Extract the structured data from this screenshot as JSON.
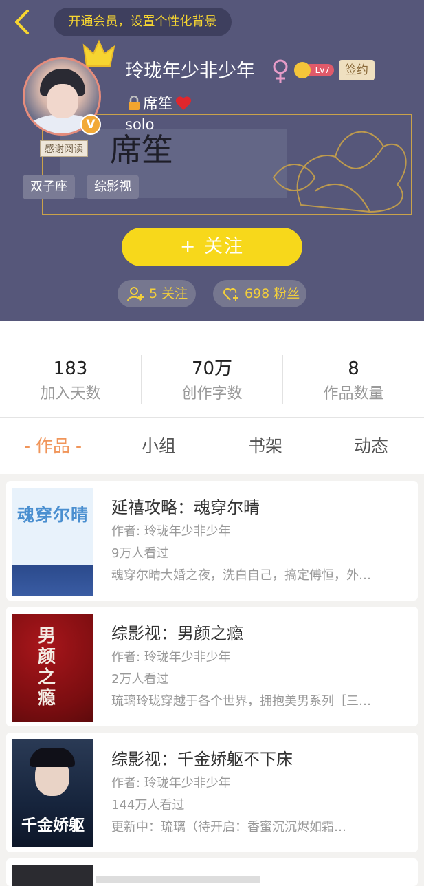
{
  "header": {
    "vip_banner": "开通会员，设置个性化背景",
    "avatar_caption": "感谢阅读",
    "badge_letter": "V",
    "tags": [
      "双子座",
      "综影视"
    ],
    "name": "玲珑年少非少年",
    "level": "Lv7",
    "signed": "签约",
    "pen_name": "席笙",
    "bio": "solo",
    "signature_text": "席笙",
    "follow_button": "+ 关注",
    "following": "5 关注",
    "fans": "698 粉丝",
    "colors": {
      "bg": "#56577a",
      "accent": "#f7d81b",
      "gold": "#f3cf3b"
    }
  },
  "stats": [
    {
      "value": "183",
      "label": "加入天数"
    },
    {
      "value": "70万",
      "label": "创作字数"
    },
    {
      "value": "8",
      "label": "作品数量"
    }
  ],
  "tabs": [
    "- 作品 -",
    "小组",
    "书架",
    "动态"
  ],
  "works": [
    {
      "title": "延禧攻略：魂穿尔晴",
      "author": "作者: 玲珑年少非少年",
      "views": "9万人看过",
      "desc": "魂穿尔晴大婚之夜，洗白自己，搞定傅恒，外…",
      "cover_text": "魂穿尔晴"
    },
    {
      "title": "综影视：男颜之瘾",
      "author": "作者: 玲珑年少非少年",
      "views": "2万人看过",
      "desc": "琉璃玲珑穿越于各个世界，拥抱美男系列［三…",
      "cover_text": "男颜之瘾"
    },
    {
      "title": "综影视：千金娇躯不下床",
      "author": "作者: 玲珑年少非少年",
      "views": "144万人看过",
      "desc": "更新中：琉璃（待开启：香蜜沉沉烬如霜…",
      "cover_text": "千金娇躯"
    },
    {
      "title": "",
      "author": "",
      "views": "",
      "desc": "",
      "cover_text": ""
    }
  ]
}
